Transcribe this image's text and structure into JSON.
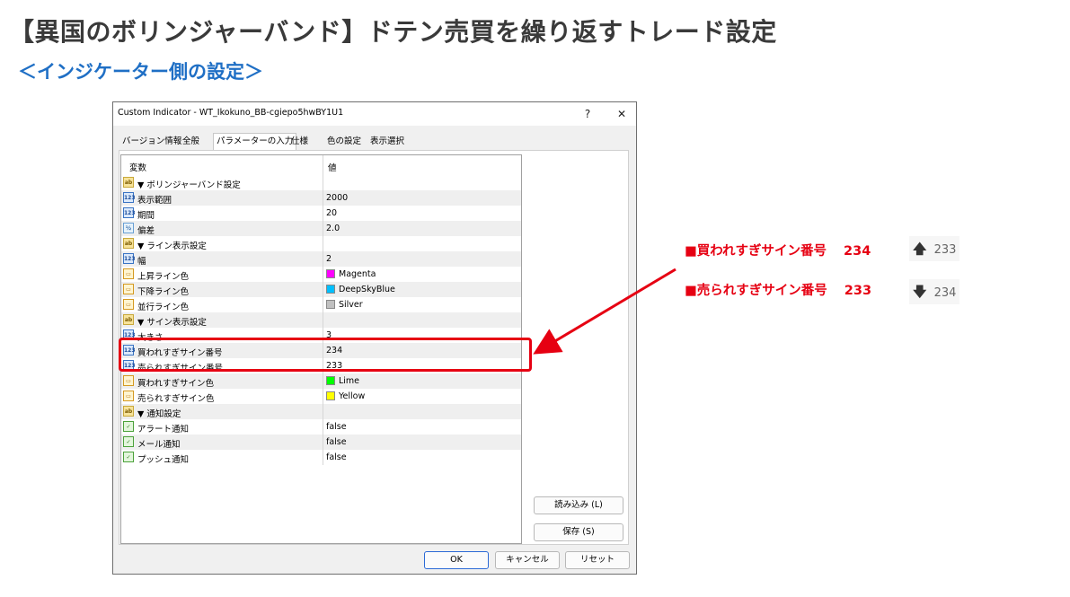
{
  "page": {
    "title": "【異国のボリンジャーバンド】ドテン売買を繰り返すトレード設定",
    "subtitle": "＜インジケーター側の設定＞"
  },
  "dialog": {
    "title": "Custom Indicator - WT_Ikokuno_BB-cgiepo5hwBY1U1",
    "help": "?",
    "close": "✕",
    "tabs": [
      "バージョン情報",
      "全般",
      "パラメーターの入力",
      "仕様",
      "色の設定",
      "表示選択"
    ],
    "active_tab": "パラメーターの入力",
    "columns": {
      "name": "変数",
      "value": "値"
    },
    "rows": [
      {
        "icon": "ab",
        "name": "▼ ボリンジャーバンド設定",
        "value": ""
      },
      {
        "icon": "123",
        "name": "表示範囲",
        "value": "2000"
      },
      {
        "icon": "123",
        "name": "期間",
        "value": "20"
      },
      {
        "icon": "½",
        "name": "偏差",
        "value": "2.0"
      },
      {
        "icon": "ab",
        "name": "▼ ライン表示設定",
        "value": ""
      },
      {
        "icon": "123",
        "name": "幅",
        "value": "2"
      },
      {
        "icon": "clr",
        "name": "上昇ライン色",
        "value": "Magenta",
        "swatch": "#ff00ff"
      },
      {
        "icon": "clr",
        "name": "下降ライン色",
        "value": "DeepSkyBlue",
        "swatch": "#00bfff"
      },
      {
        "icon": "clr",
        "name": "並行ライン色",
        "value": "Silver",
        "swatch": "#c0c0c0"
      },
      {
        "icon": "ab",
        "name": "▼ サイン表示設定",
        "value": ""
      },
      {
        "icon": "123",
        "name": "大きさ",
        "value": "3"
      },
      {
        "icon": "123",
        "name": "買われすぎサイン番号",
        "value": "234"
      },
      {
        "icon": "123",
        "name": "売られすぎサイン番号",
        "value": "233"
      },
      {
        "icon": "clr",
        "name": "買われすぎサイン色",
        "value": "Lime",
        "swatch": "#00ff00"
      },
      {
        "icon": "clr",
        "name": "売られすぎサイン色",
        "value": "Yellow",
        "swatch": "#ffff00"
      },
      {
        "icon": "ab",
        "name": "▼ 通知設定",
        "value": ""
      },
      {
        "icon": "bool",
        "name": "アラート通知",
        "value": "false"
      },
      {
        "icon": "bool",
        "name": "メール通知",
        "value": "false"
      },
      {
        "icon": "bool",
        "name": "プッシュ通知",
        "value": "false"
      }
    ],
    "buttons": {
      "load": "読み込み (L)",
      "save": "保存 (S)",
      "ok": "OK",
      "cancel": "キャンセル",
      "reset": "リセット"
    }
  },
  "annotations": {
    "buy": {
      "label": "■買われすぎサイン番号",
      "number": "234",
      "chip_value": "233"
    },
    "sell": {
      "label": "■売られすぎサイン番号",
      "number": "233",
      "chip_value": "234"
    },
    "accent_color": "#e60012"
  }
}
